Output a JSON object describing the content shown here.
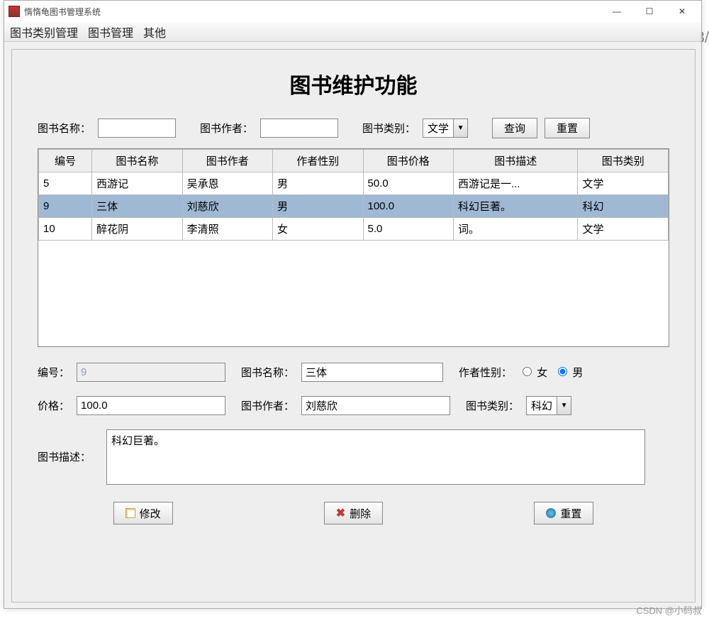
{
  "window": {
    "title": "惰惰龟图书管理系统"
  },
  "menu": {
    "cat": "图书类别管理",
    "book": "图书管理",
    "other": "其他"
  },
  "page_title": "图书维护功能",
  "search": {
    "name_lbl": "图书名称：",
    "author_lbl": "图书作者：",
    "cat_lbl": "图书类别：",
    "cat_value": "文学",
    "query": "查询",
    "reset": "重置"
  },
  "th": {
    "id": "编号",
    "name": "图书名称",
    "author": "图书作者",
    "gender": "作者性别",
    "price": "图书价格",
    "desc": "图书描述",
    "cat": "图书类别"
  },
  "rows": [
    {
      "id": "5",
      "name": "西游记",
      "author": "吴承恩",
      "gender": "男",
      "price": "50.0",
      "desc": "西游记是一...",
      "cat": "文学"
    },
    {
      "id": "9",
      "name": "三体",
      "author": "刘慈欣",
      "gender": "男",
      "price": "100.0",
      "desc": "科幻巨著。",
      "cat": "科幻"
    },
    {
      "id": "10",
      "name": "醉花阴",
      "author": "李清照",
      "gender": "女",
      "price": "5.0",
      "desc": "词。",
      "cat": "文学"
    }
  ],
  "form": {
    "id_lbl": "编号：",
    "id_val": "9",
    "name_lbl": "图书名称：",
    "name_val": "三体",
    "gender_lbl": "作者性别：",
    "female": "女",
    "male": "男",
    "gender_sel": "男",
    "price_lbl": "价格：",
    "price_val": "100.0",
    "author_lbl": "图书作者：",
    "author_val": "刘慈欣",
    "cat_lbl": "图书类别：",
    "cat_val": "科幻",
    "desc_lbl": "图书描述：",
    "desc_val": "科幻巨著。"
  },
  "actions": {
    "modify": "修改",
    "delete": "删除",
    "reset": "重置"
  },
  "watermark": "CSDN @小码叔",
  "ghost": "3/"
}
